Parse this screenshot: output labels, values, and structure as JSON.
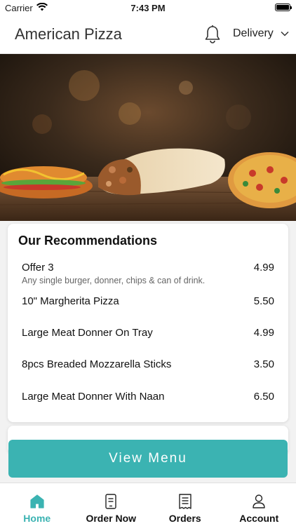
{
  "status_bar": {
    "carrier": "Carrier",
    "time": "7:43 PM"
  },
  "header": {
    "title": "American Pizza",
    "delivery_label": "Delivery"
  },
  "recommendations": {
    "title": "Our Recommendations",
    "items": [
      {
        "name": "Offer 3",
        "price": "4.99",
        "description": "Any single burger, donner, chips & can of drink."
      },
      {
        "name": "10\" Margherita Pizza",
        "price": "5.50"
      },
      {
        "name": "Large Meat Donner On Tray",
        "price": "4.99"
      },
      {
        "name": "8pcs Breaded Mozzarella Sticks",
        "price": "3.50"
      },
      {
        "name": "Large Meat Donner With Naan",
        "price": "6.50"
      }
    ]
  },
  "view_menu_label": "View Menu",
  "tabs": [
    {
      "label": "Home",
      "icon": "home-icon",
      "active": true
    },
    {
      "label": "Order Now",
      "icon": "order-icon"
    },
    {
      "label": "Orders",
      "icon": "receipt-icon"
    },
    {
      "label": "Account",
      "icon": "account-icon"
    }
  ],
  "colors": {
    "accent": "#3bb3b2"
  }
}
